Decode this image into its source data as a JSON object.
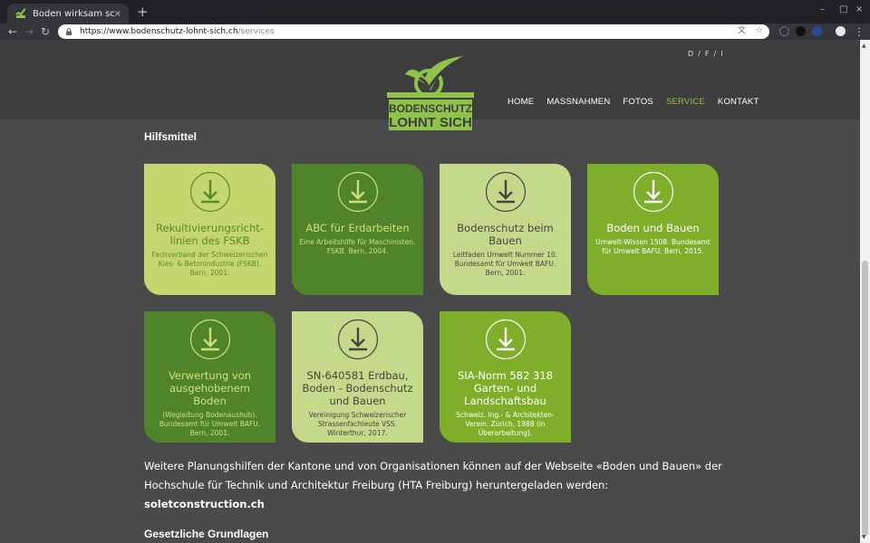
{
  "browser": {
    "tab_title": "Boden wirksam schützen",
    "tab_close": "×",
    "newtab": "+",
    "min": "–",
    "max": "□",
    "close": "×",
    "back": "←",
    "forward": "→",
    "reload": "↻",
    "url_host": "https://www.bodenschutz-lohnt-sich.ch",
    "url_path": "/services",
    "menu": "⋮"
  },
  "header": {
    "languages": [
      "D",
      "/",
      "F",
      "/",
      "I"
    ],
    "logo_line1": "BODENSCHUTZ",
    "logo_line2": "LOHNT SICH",
    "nav": [
      "HOME",
      "MASSNAHMEN",
      "FOTOS",
      "SERVICE",
      "KONTAKT"
    ],
    "active_nav": "SERVICE"
  },
  "section1": {
    "title": "Hilfsmittel"
  },
  "cards": [
    {
      "title": "Rekultivierungsricht-linien des FSKB",
      "desc": "Fachverband der Schweizerischen Kies- & Betonindustrie (FSKB). Bern, 2001."
    },
    {
      "title": "ABC für Erdarbeiten",
      "desc": "Eine Arbeitshilfe für Maschinisten. FSKB. Bern, 2004."
    },
    {
      "title": "Bodenschutz beim Bauen",
      "desc": "Leitfaden Umwelt Nummer 10. Bundesamt für Umwelt BAFU. Bern, 2001."
    },
    {
      "title": "Boden und Bauen",
      "desc": "Umwelt-Wissen 1508. Bundesamt für Umwelt BAFU. Bern, 2015."
    },
    {
      "title": "Verwertung von ausgehobenem Boden",
      "desc": "(Wegleitung Bodenaushub). Bundesamt für Umwelt BAFU. Bern, 2001."
    },
    {
      "title": "SN-640581 Erdbau, Boden - Bodenschutz und Bauen",
      "desc": "Vereinigung Schweizerischer Strassenfachleute VSS. Winterthur, 2017."
    },
    {
      "title": "SIA-Norm 582 318 Garten- und Landschaftsbau",
      "desc": "Schweiz. Ing.- & Architekten-Verein. Zürich, 1988 (in Überarbeitung)."
    }
  ],
  "card_colors": [
    {
      "bg": "#c5d66e",
      "fg": "#5b8a2a",
      "icon": "#5b8a2a"
    },
    {
      "bg": "#4f842a",
      "fg": "#cfe07a",
      "icon": "#cfe07a"
    },
    {
      "bg": "#c4d98a",
      "fg": "#454545",
      "icon": "#454545"
    },
    {
      "bg": "#7fae2a",
      "fg": "#ffffff",
      "icon": "#ffffff"
    },
    {
      "bg": "#4f842a",
      "fg": "#cfe07a",
      "icon": "#cfe07a"
    },
    {
      "bg": "#c4d98a",
      "fg": "#454545",
      "icon": "#454545"
    },
    {
      "bg": "#7fae2a",
      "fg": "#ffffff",
      "icon": "#ffffff"
    }
  ],
  "paragraph": {
    "text": "Weitere Planungshilfen der Kantone und von Organisationen können auf der Webseite «Boden und Bauen» der Hochschule für Technik und Architektur Freiburg (HTA Freiburg) heruntergeladen werden: ",
    "link": "soletconstruction.ch"
  },
  "section2": {
    "title": "Gesetzliche Grundlagen"
  },
  "colors": {
    "accent": "#8fc34a",
    "page_bg": "#4a4a4a",
    "header_bg": "#3e3e3e"
  }
}
